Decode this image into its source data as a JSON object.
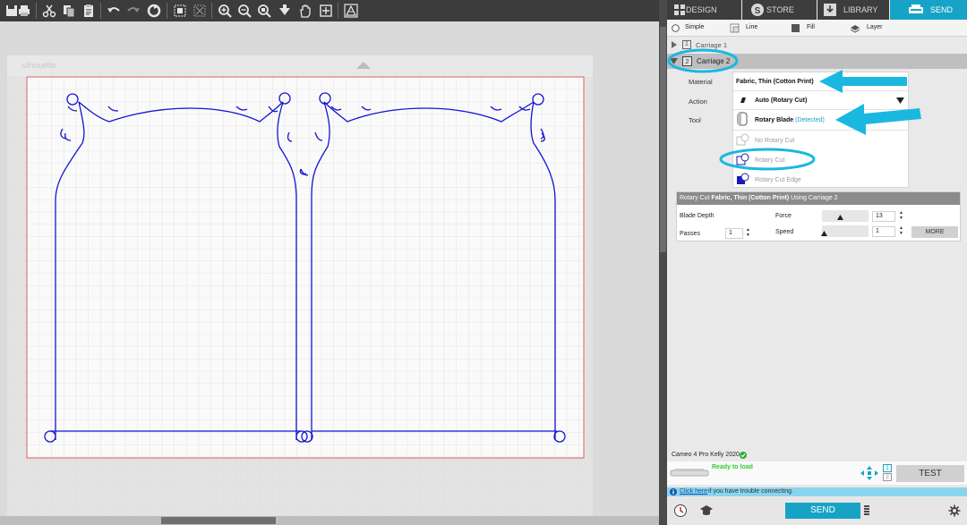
{
  "toolbar": {
    "icons": [
      "save-icon",
      "print-icon",
      "cut-icon",
      "copy-icon",
      "paste-icon",
      "undo-icon",
      "redo-icon",
      "refresh-icon",
      "group-icon",
      "ungroup-icon",
      "zoom-in-icon",
      "zoom-out-icon",
      "zoom-select-icon",
      "pan-down-icon",
      "hand-icon",
      "fit-icon",
      "trace-icon"
    ]
  },
  "canvas": {
    "watermark": "silhouette"
  },
  "top_tabs": [
    {
      "label": "DESIGN",
      "icon": "grid-icon"
    },
    {
      "label": "STORE",
      "icon": "silhouette-s-icon"
    },
    {
      "label": "LIBRARY",
      "icon": "download-icon"
    },
    {
      "label": "SEND",
      "icon": "cutter-icon",
      "active": true
    }
  ],
  "modes": [
    {
      "label": "Simple",
      "icon": "radio-icon"
    },
    {
      "label": "Line",
      "icon": "line-mode-icon"
    },
    {
      "label": "Fill",
      "icon": "fill-mode-icon"
    },
    {
      "label": "Layer",
      "icon": "layer-mode-icon"
    }
  ],
  "carriage1": {
    "number": "1",
    "label": "Carriage 1"
  },
  "carriage2": {
    "number": "2",
    "label": "Carriage 2"
  },
  "fields": {
    "material_label": "Material",
    "material_value": "Fabric, Thin (Cotton Print)",
    "action_label": "Action",
    "action_value": "Auto (Rotary Cut)",
    "tool_label": "Tool",
    "tool_value": "Rotary Blade",
    "tool_status": "(Detected)",
    "options": [
      "No Rotary Cut",
      "Rotary Cut",
      "Rotary Cut Edge"
    ]
  },
  "settings": {
    "header_prefix": "Rotary Cut",
    "header_material": "Fabric, Thin (Cotton Print)",
    "header_suffix": "Using Carriage 2",
    "blade_depth_label": "Blade Depth",
    "force_label": "Force",
    "force_value": "13",
    "passes_label": "Passes",
    "passes_value": "1",
    "speed_label": "Speed",
    "speed_value": "1",
    "more_label": "MORE"
  },
  "device": {
    "name": "Cameo 4 Pro Kelly 2020",
    "status": "Ready to load",
    "test_label": "TEST",
    "carriage_nums": [
      "1",
      "2"
    ]
  },
  "help": {
    "link": "Click here",
    "text": "if you have trouble connecting."
  },
  "bottom": {
    "send_label": "SEND"
  },
  "colors": {
    "accent": "#17a3c5",
    "cut_line": "#1414d2",
    "mat_border": "#e06060",
    "ready": "#2fcf2f",
    "annotation": "#1ab8e0"
  }
}
